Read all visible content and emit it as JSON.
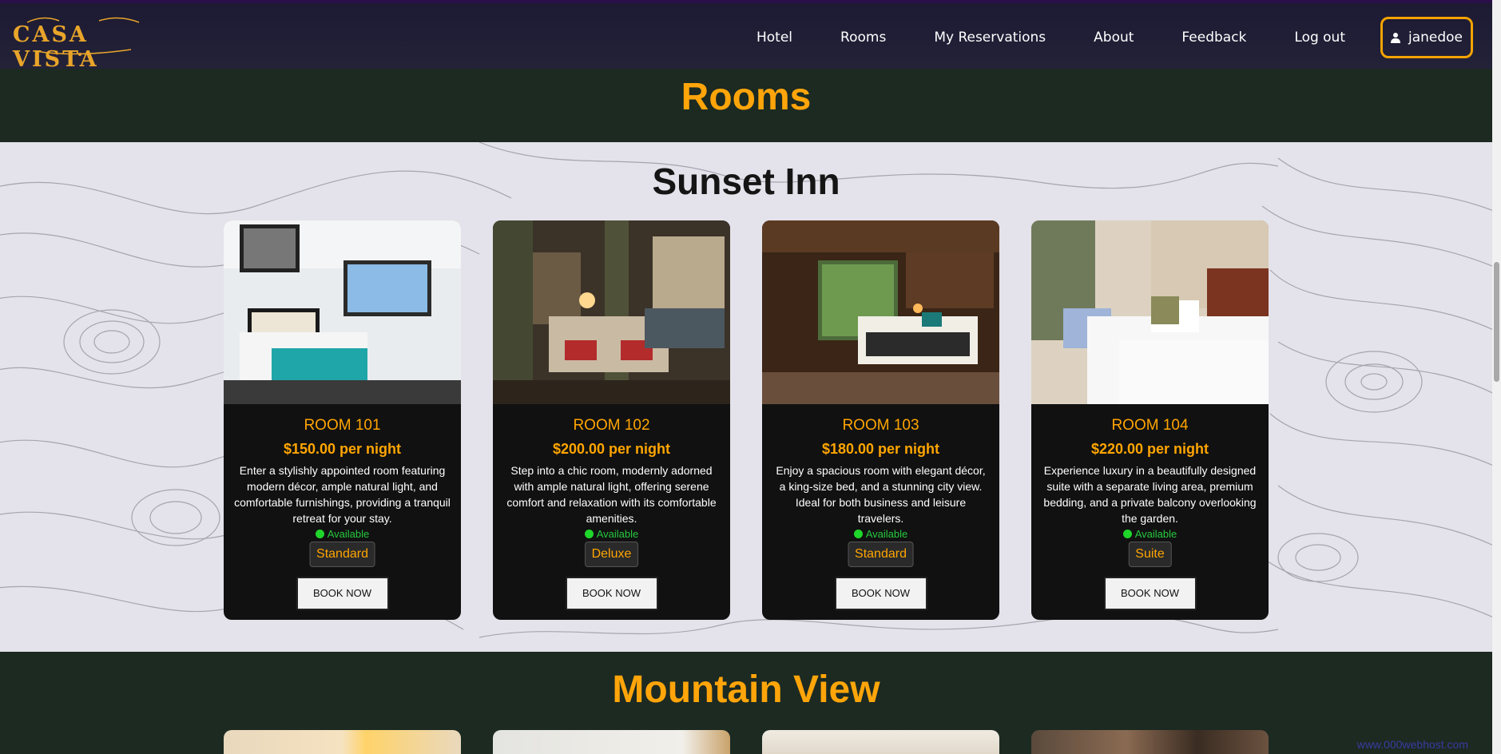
{
  "nav": {
    "logo_text": "CASA VISTA",
    "links": [
      "Hotel",
      "Rooms",
      "My Reservations",
      "About",
      "Feedback",
      "Log out"
    ],
    "username": "janedoe"
  },
  "page_title": "Rooms",
  "hotels": [
    {
      "name": "Sunset Inn",
      "rooms": [
        {
          "title": "ROOM 101",
          "price": "$150.00 per night",
          "description": "Enter a stylishly appointed room featuring modern décor, ample natural light, and comfortable furnishings, providing a tranquil retreat for your stay.",
          "status": "Available",
          "type": "Standard",
          "button": "BOOK NOW"
        },
        {
          "title": "ROOM 102",
          "price": "$200.00 per night",
          "description": "Step into a chic room, modernly adorned with ample natural light, offering serene comfort and relaxation with its comfortable amenities.",
          "status": "Available",
          "type": "Deluxe",
          "button": "BOOK NOW"
        },
        {
          "title": "ROOM 103",
          "price": "$180.00 per night",
          "description": "Enjoy a spacious room with elegant décor, a king-size bed, and a stunning city view. Ideal for both business and leisure travelers.",
          "status": "Available",
          "type": "Standard",
          "button": "BOOK NOW"
        },
        {
          "title": "ROOM 104",
          "price": "$220.00 per night",
          "description": "Experience luxury in a beautifully designed suite with a separate living area, premium bedding, and a private balcony overlooking the garden.",
          "status": "Available",
          "type": "Suite",
          "button": "BOOK NOW"
        }
      ]
    },
    {
      "name": "Mountain View"
    }
  ],
  "broken_image_alt": "www.000webhost.com",
  "colors": {
    "accent": "#ffa500",
    "nav_bg": "#1d1a33",
    "band_bg": "#1c2a22",
    "available": "#1fd62a"
  }
}
